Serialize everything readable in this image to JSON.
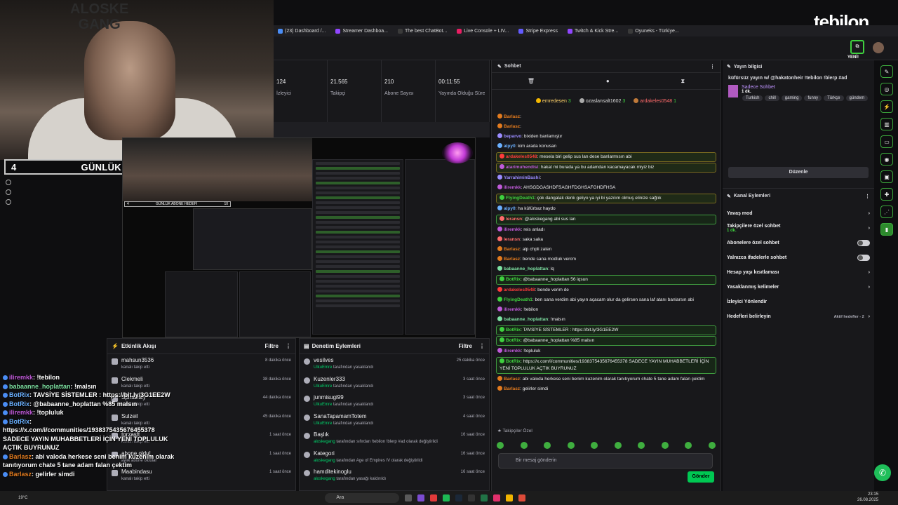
{
  "watermark": {
    "line1": "ALOSKE",
    "line2": "GANG"
  },
  "logo": "tebilon",
  "browser_tabs": [
    "(23) Dashboard /...",
    "Streamer Dashboa...",
    "The best ChatBot...",
    "Live Console + LIV...",
    "Stripe Express",
    "Twitch & Kick Stre...",
    "Oyuneks - Türkiye..."
  ],
  "goal": {
    "current": "4",
    "title": "GÜNLÜK ABONE HEDEFİ",
    "target": "10"
  },
  "stats": [
    {
      "value": "124",
      "label": "İzleyici"
    },
    {
      "value": "21.565",
      "label": "Takipçi"
    },
    {
      "value": "210",
      "label": "Abone Sayısı"
    },
    {
      "value": "00:11:55",
      "label": "Yayında Olduğu Süre"
    }
  ],
  "activity": {
    "title": "Etkinlik Akışı",
    "filter": "Filtre",
    "items": [
      {
        "name": "mahsun3536",
        "sub": "kanalı takip etti",
        "time": "8 dakika önce"
      },
      {
        "name": "Clekmeli",
        "sub": "kanalı takip etti",
        "time": "38 dakika önce"
      },
      {
        "name": "Spiraslaiy",
        "sub": "kanalı takip etti",
        "time": "44 dakika önce"
      },
      {
        "name": "Sulzeil",
        "sub": "kanalı takip etti",
        "time": "45 dakika önce"
      },
      {
        "name": "forzasff",
        "sub": "kanalı takip etti",
        "time": "1 saat önce"
      },
      {
        "name": "abone oldu!",
        "sub": "aylık abone oldular",
        "time": "1 saat önce"
      },
      {
        "name": "Maabindasu",
        "sub": "kanalı takip etti",
        "time": "1 saat önce"
      }
    ]
  },
  "moderation": {
    "title": "Denetim Eylemleri",
    "filter": "Filtre",
    "items": [
      {
        "name": "vesilves",
        "by": "UlkuEmre",
        "sub": "tarafından yasaklandı",
        "time": "25 dakika önce"
      },
      {
        "name": "Kuzenler333",
        "by": "UlkuEmre",
        "sub": "tarafından yasaklandı",
        "time": "3 saat önce"
      },
      {
        "name": "junmisugi99",
        "by": "UlkuEmre",
        "sub": "tarafından yasaklandı",
        "time": "3 saat önce"
      },
      {
        "name": "SanaTapamamTotem",
        "by": "UlkuEmre",
        "sub": "tarafından yasaklandı",
        "time": "4 saat önce"
      },
      {
        "name": "Başlık",
        "by": "aloskegang",
        "sub": "tarafından sıfırdan !tebilon !blerp #ad olarak değiştirildi",
        "time": "16 saat önce"
      },
      {
        "name": "Kategori",
        "by": "aloskegang",
        "sub": "tarafından Age of Empires IV olarak değiştirildi",
        "time": "16 saat önce"
      },
      {
        "name": "hamditekinoglu",
        "by": "aloskegang",
        "sub": "tarafından yasağı kaldırıldı",
        "time": "16 saat önce"
      }
    ]
  },
  "chat": {
    "title": "Sohbet",
    "top_gifters": [
      {
        "name": "emredesen",
        "count": "3"
      },
      {
        "name": "ozaslansalt1602",
        "count": "3"
      },
      {
        "name": "ardakeles0548",
        "count": "1"
      }
    ],
    "messages": [
      {
        "user": "Barlasz",
        "text": "",
        "color": "#e37b1e",
        "hl": ""
      },
      {
        "user": "Barlasz",
        "text": "",
        "color": "#e37b1e",
        "hl": ""
      },
      {
        "user": "beparvo",
        "text": "bixiden banlamıştır",
        "color": "#9b8cff",
        "hl": ""
      },
      {
        "user": "alpy0",
        "text": "kim arada konusan",
        "color": "#6ab0ff",
        "hl": ""
      },
      {
        "user": "ardakeles0548",
        "text": "mesela biri gelip sus lan dese banlarmısın abi",
        "color": "#ff3b3b",
        "hl": "hl"
      },
      {
        "user": "atarimuhendisi",
        "text": "hakat mi burada ya bu adamdan kacamayacak miyiz biz",
        "color": "#c05ad9",
        "hl": "hl"
      },
      {
        "user": "YarrahiminBashi",
        "text": "",
        "color": "#9b8cff",
        "hl": ""
      },
      {
        "user": "iliremkk",
        "text": "AHSGDGASHDFSAGHFDGHSAFGHDFHSA",
        "color": "#c05ad9",
        "hl": ""
      },
      {
        "user": "FlyingDeath1",
        "text": "çok dangalak denk geliyo ya iyi bi yazılım olmuş elinize sağlık",
        "color": "#3fd13f",
        "hl": "hl"
      },
      {
        "user": "alpy0",
        "text": "ha küfürbaz haydo",
        "color": "#6ab0ff",
        "hl": ""
      },
      {
        "user": "leransn",
        "text": "@aloskegang abi sus lan",
        "color": "#ff6b6b",
        "hl": "hlg"
      },
      {
        "user": "iliremkk",
        "text": "reis anladı",
        "color": "#c05ad9",
        "hl": ""
      },
      {
        "user": "leransn",
        "text": "saka saka",
        "color": "#ff6b6b",
        "hl": ""
      },
      {
        "user": "Barlasz",
        "text": "alp chpli zaten",
        "color": "#e37b1e",
        "hl": ""
      },
      {
        "user": "Barlasz",
        "text": "bende sana modluk vercm",
        "color": "#e37b1e",
        "hl": ""
      },
      {
        "user": "babaanne_hoplattan",
        "text": "lq",
        "color": "#7ee3a3",
        "hl": ""
      },
      {
        "user": "BotRix",
        "text": "@babaanne_hoplattan 56 iqsun",
        "color": "#3fd13f",
        "hl": "hlg"
      },
      {
        "user": "ardakeles0548",
        "text": "bende verim de",
        "color": "#ff3b3b",
        "hl": ""
      },
      {
        "user": "FlyingDeath1",
        "text": "ben sana verdim abi yayın açacam olur da gelirsen sana laf atanı banlarsın abi",
        "color": "#3fd13f",
        "hl": "wrap"
      },
      {
        "user": "iliremkk",
        "text": "!tebilon",
        "color": "#c05ad9",
        "hl": ""
      },
      {
        "user": "babaanne_hoplattan",
        "text": "!malsın",
        "color": "#7ee3a3",
        "hl": ""
      },
      {
        "user": "BotRix",
        "text": "TAVSİYE SİSTEMLER : https://bit.ly/3G1EE2W",
        "color": "#3fd13f",
        "hl": "hlg"
      },
      {
        "user": "BotRix",
        "text": "@babaanne_hoplattan %85 malsın",
        "color": "#3fd13f",
        "hl": "hlg"
      },
      {
        "user": "iliremkk",
        "text": "!topluluk",
        "color": "#c05ad9",
        "hl": ""
      },
      {
        "user": "BotRix",
        "text": "https://x.com/i/communities/1938375435676455378 SADECE YAYIN MUHABBETLERİ İÇİN YENİ TOPLULUK AÇTIK BUYRUNUZ",
        "color": "#3fd13f",
        "hl": "hlg wrap"
      },
      {
        "user": "Barlasz",
        "text": "abi valoda herkese seni benim kuzenim olarak tanıtıyorum chate 5 tane adam falan çektim",
        "color": "#e37b1e",
        "hl": "wrap"
      },
      {
        "user": "Barlasz",
        "text": "gelirler simdi",
        "color": "#e37b1e",
        "hl": ""
      }
    ],
    "followers_only": "Takipçiler Özel",
    "input_placeholder": "Bir mesaj gönderin",
    "send_label": "Gönder"
  },
  "stream_info": {
    "title": "Yayın bilgisi",
    "stream_title": "küfürsüz yayın w/ @hakatonheir !tebilon !blerp #ad",
    "category": "Sadece Sohbet",
    "duration": "1 dk.",
    "tags": [
      "Turkish",
      "chill",
      "gaming",
      "funny",
      "Türkçe",
      "gündem"
    ],
    "edit_label": "Düzenle",
    "new_badge": "YENİ!"
  },
  "channel_actions": {
    "title": "Kanal Eylemleri",
    "items": [
      {
        "label": "Yavaş mod",
        "type": "arrow"
      },
      {
        "label": "Takipçilere özel sohbet",
        "sub": "1 dk.",
        "type": "arrow"
      },
      {
        "label": "Abonelere özel sohbet",
        "type": "toggle"
      },
      {
        "label": "Yalnızca ifadelerle sohbet",
        "type": "toggle"
      },
      {
        "label": "Hesap yaşı kısıtlaması",
        "type": "arrow"
      },
      {
        "label": "Yasaklanmış kelimeler",
        "type": "arrow"
      },
      {
        "label": "İzleyici Yönlendir",
        "type": "none"
      },
      {
        "label": "Hedefleri belirleyin",
        "type": "arrow",
        "extra": "Aktif hedefler - 2"
      }
    ]
  },
  "overlay_chat": [
    {
      "user": "iliremkk",
      "text": ": !tebilon",
      "cls": "ir"
    },
    {
      "user": "babaanne_hoplattan",
      "text": ": !malsın",
      "cls": "bb"
    },
    {
      "user": "BotRix",
      "text": ": TAVSİYE SİSTEMLER : https://bit.ly/3G1EE2W",
      "cls": "bx"
    },
    {
      "user": "BotRix",
      "text": ": @babaanne_hoplattan %85 malsın",
      "cls": "bx"
    },
    {
      "user": "iliremkk",
      "text": ": !topluluk",
      "cls": "ir"
    },
    {
      "user": "BotRix",
      "text": ":",
      "cls": "bx"
    },
    {
      "user": "",
      "text": "https://x.com/i/communities/1938375435676455378",
      "cls": ""
    },
    {
      "user": "",
      "text": "SADECE YAYIN MUHABBETLERİ İÇİN YENİ TOPLULUK",
      "cls": ""
    },
    {
      "user": "",
      "text": "AÇTIK BUYRUNUZ",
      "cls": ""
    },
    {
      "user": "Barlasz",
      "text": ": abi valoda herkese seni benim kuzenim olarak",
      "cls": "ba"
    },
    {
      "user": "",
      "text": "tanıtıyorum chate 5 tane adam falan çektim",
      "cls": ""
    },
    {
      "user": "Barlasz",
      "text": ": gelirler simdi",
      "cls": "ba"
    }
  ],
  "taskbar": {
    "search": "Ara",
    "time": "23:15",
    "date": "26.08.2025",
    "weather": "19°C"
  }
}
